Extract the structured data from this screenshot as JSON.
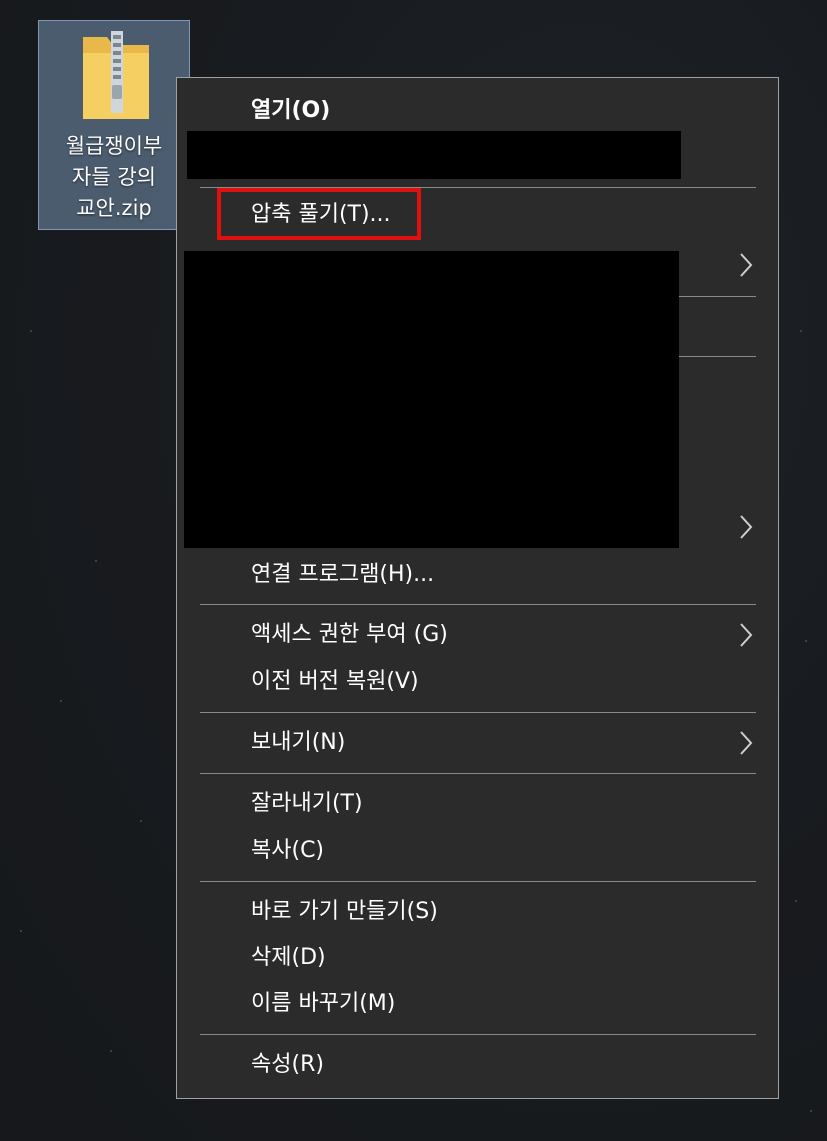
{
  "desktop_icon": {
    "icon": "zip-folder-icon",
    "label": "월급쟁이부\n자들 강의\n교안.zip"
  },
  "context_menu": {
    "items": {
      "open": "열기(O)",
      "extract": "압축 풀기(T)...",
      "open_with": "연결 프로그램(H)...",
      "give_access": "액세스 권한 부여 (G)",
      "restore_versions": "이전 버전 복원(V)",
      "send_to": "보내기(N)",
      "cut": "잘라내기(T)",
      "copy": "복사(C)",
      "create_shortcut": "바로 가기 만들기(S)",
      "delete": "삭제(D)",
      "rename": "이름 바꾸기(M)",
      "properties": "속성(R)"
    },
    "submenu_icon": "chevron-right-icon",
    "highlight_color": "#e01010"
  }
}
